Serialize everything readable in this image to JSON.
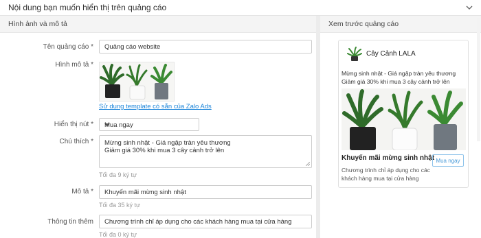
{
  "header": {
    "title": "Nội dung bạn muốn hiển thị trên quảng cáo"
  },
  "left_section": {
    "title": "Hình ảnh và mô tả"
  },
  "right_section": {
    "title": "Xem trước quảng cáo"
  },
  "form": {
    "ad_name": {
      "label": "Tên quảng cáo *",
      "value": "Quảng cáo website"
    },
    "image": {
      "label": "Hình mô tả *",
      "template_link": "Sử dụng template có sẵn của Zalo Ads"
    },
    "button": {
      "label": "Hiển thị nút *",
      "value": "Mua ngay"
    },
    "note": {
      "label": "Chú thích *",
      "line1": "Mừng sinh nhật - Giá ngập tràn yêu thương",
      "line2": "Giảm giá 30% khi mua 3 cây cảnh trở lên",
      "hint": "Tối đa 9 ký tự"
    },
    "desc": {
      "label": "Mô tả *",
      "value": "Khuyến mãi mừng sinh nhật",
      "hint": "Tối đa 35 ký tự"
    },
    "extra": {
      "label": "Thông tin thêm",
      "value": "Chương trình chỉ áp dụng cho các khách hàng mua tại cửa hàng",
      "hint": "Tối đa 0 ký tự"
    }
  },
  "preview": {
    "brand_name": "Cây Cảnh LALA",
    "note_line1": "Mừng sinh nhật - Giá ngập tràn yêu thương",
    "note_line2": "Giảm giá 30% khi mua 3 cây cảnh trở lên",
    "title": "Khuyến mãi mừng sinh nhật",
    "desc_line1": "Chương trình chỉ áp dụng cho các",
    "desc_line2": "khách hàng mua tại cửa hàng",
    "button": "Mua ngay"
  },
  "colors": {
    "link": "#1a84d9",
    "preview_button": "#4a9bd8",
    "section_bg": "#f4f4f4"
  }
}
